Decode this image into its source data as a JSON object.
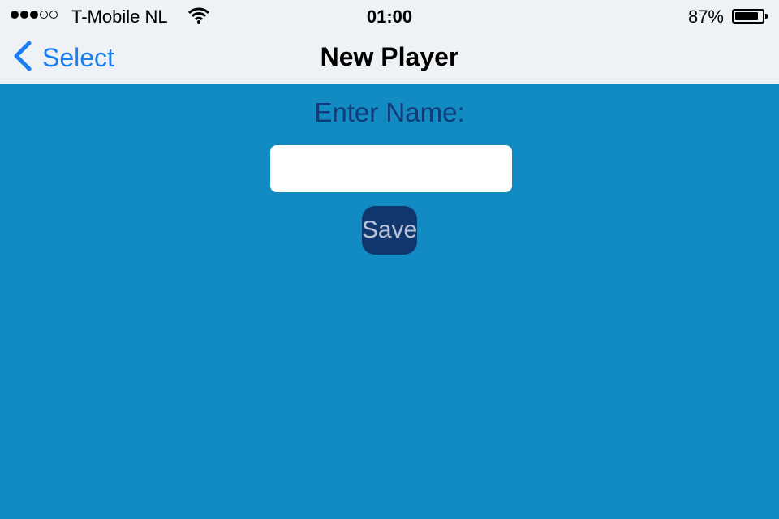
{
  "status_bar": {
    "signal_filled": 3,
    "signal_total": 5,
    "carrier": "T-Mobile NL",
    "time": "01:00",
    "battery_percent_label": "87%",
    "battery_level": 0.87
  },
  "nav_bar": {
    "back_label": "Select",
    "title": "New Player",
    "accent_color": "#1a7ef2"
  },
  "form": {
    "prompt": "Enter Name:",
    "name_value": "",
    "name_placeholder": "",
    "save_label": "Save"
  },
  "colors": {
    "background": "#118bc2",
    "label": "#103a78",
    "button": "#12366e"
  }
}
